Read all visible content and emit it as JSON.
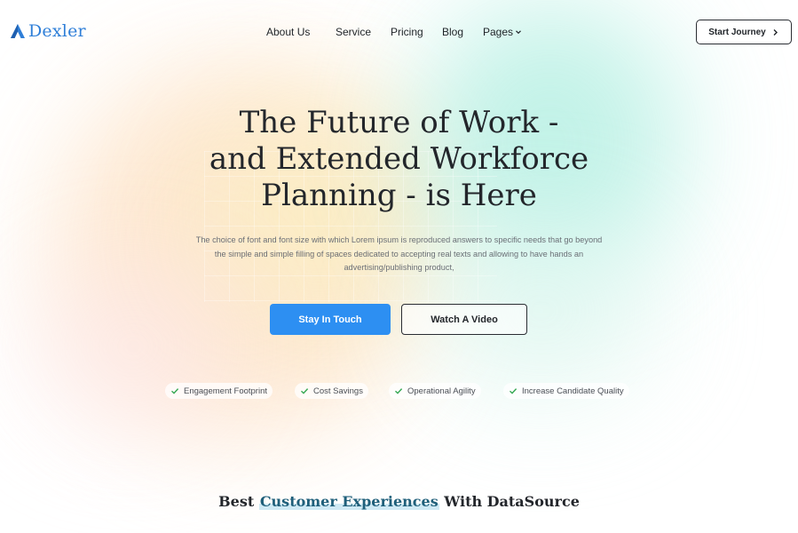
{
  "brand": {
    "name": "Dexler",
    "accent": "#2f7fd8",
    "icon": "a-logo-icon"
  },
  "nav": {
    "items": [
      {
        "label": "About Us"
      },
      {
        "label": "Service"
      },
      {
        "label": "Pricing"
      },
      {
        "label": "Blog"
      },
      {
        "label": "Pages",
        "icon": "chevron-down-icon"
      }
    ]
  },
  "header_cta": {
    "label": "Start Journey",
    "icon": "chevron-right-icon"
  },
  "hero": {
    "title_lines": [
      "The Future of Work -",
      "and Extended Workforce",
      "Planning - is Here"
    ],
    "description_lines": [
      "The choice of font and font size with which Lorem ipsum is reproduced answers to specific needs that go beyond",
      "the simple and simple filling of spaces dedicated to accepting real texts and allowing to have hands an",
      "advertising/publishing product,"
    ],
    "primary_button": "Stay In Touch",
    "secondary_button": "Watch A Video",
    "primary_color": "#2d8ff2"
  },
  "features": [
    {
      "label": "Engagement Footprint",
      "icon": "check-icon"
    },
    {
      "label": "Cost Savings",
      "icon": "check-icon"
    },
    {
      "label": "Operational Agility",
      "icon": "check-icon"
    },
    {
      "label": "Increase Candidate Quality",
      "icon": "check-icon"
    }
  ],
  "section": {
    "title_prefix": "Best",
    "title_highlight": "Customer Experiences",
    "title_suffix": "With DataSource"
  }
}
